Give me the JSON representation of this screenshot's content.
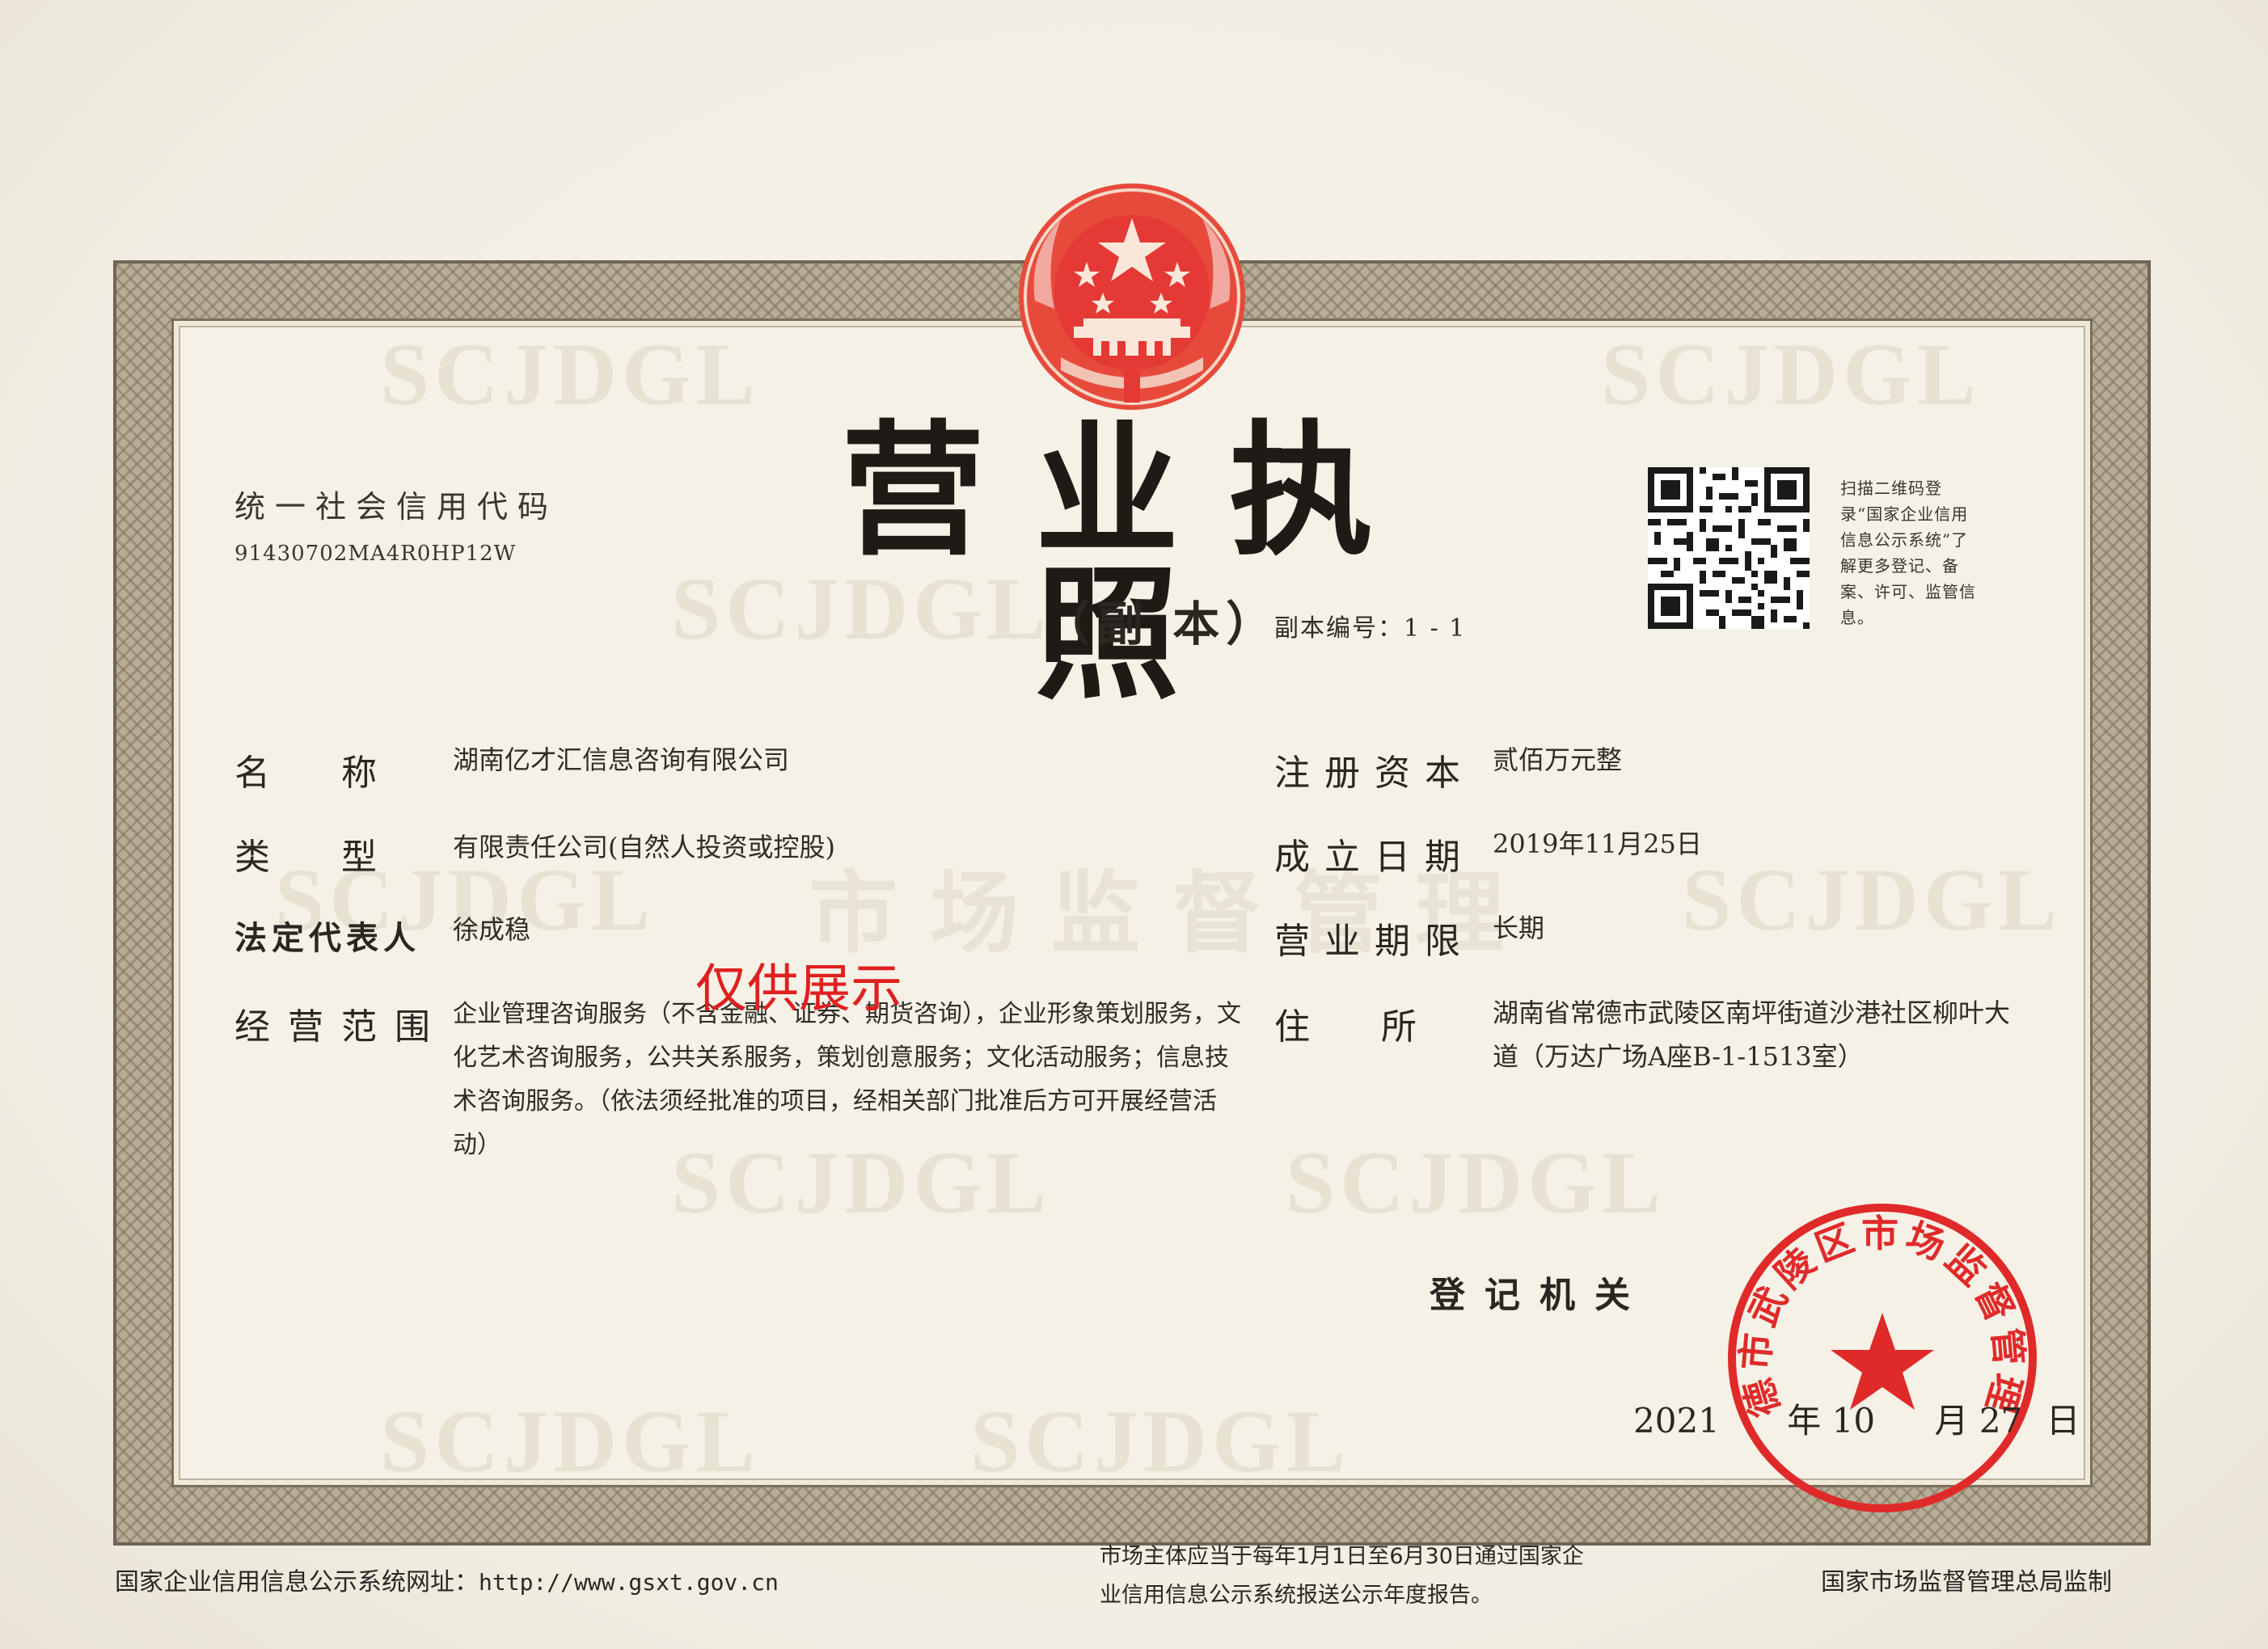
{
  "title": "营业执照",
  "subtitle": "（副 本）",
  "copy_number": "副本编号：1 - 1",
  "credit_code": {
    "label": "统一社会信用代码",
    "value": "91430702MA4R0HP12W"
  },
  "qr_note": "扫描二维码登录“国家企业信用信息公示系统”了解更多登记、备案、许可、监管信息。",
  "fields": {
    "name": {
      "label": "名　　称",
      "value": "湖南亿才汇信息咨询有限公司"
    },
    "type": {
      "label": "类　　型",
      "value": "有限责任公司(自然人投资或控股)"
    },
    "legal_rep": {
      "label": "法定代表人",
      "value": "徐成稳"
    },
    "scope": {
      "label": "经营范围",
      "value": "企业管理咨询服务（不含金融、证券、期货咨询），企业形象策划服务，文化艺术咨询服务，公共关系服务，策划创意服务；文化活动服务；信息技术咨询服务。（依法须经批准的项目，经相关部门批准后方可开展经营活动）"
    },
    "capital": {
      "label": "注册资本",
      "value": "贰佰万元整"
    },
    "established": {
      "label": "成立日期",
      "value": "2019年11月25日"
    },
    "term": {
      "label": "营业期限",
      "value": "长期"
    },
    "address": {
      "label": "住　　所",
      "value": "湖南省常德市武陵区南坪街道沙港社区柳叶大道（万达广场A座B-1-1513室）"
    }
  },
  "overlay_text": "仅供展示",
  "registration": {
    "label": "登记机关",
    "year": "2021",
    "year_unit": "年",
    "month": "10",
    "month_unit": "月",
    "day": "27",
    "day_unit": "日"
  },
  "seal_text": "常德市武陵区市场监督管理局",
  "watermark_text": "SCJDGL",
  "watermark_cn": "市场监督管理",
  "footer": {
    "left_label": "国家企业信用信息公示系统网址：",
    "left_url": "http://www.gsxt.gov.cn",
    "middle": "市场主体应当于每年1月1日至6月30日通过国家企业信用信息公示系统报送公示年度报告。",
    "right": "国家市场监督管理总局监制"
  },
  "colors": {
    "seal_red": "#e02a2a",
    "border": "#b8ad97",
    "ink": "#2a2622"
  }
}
